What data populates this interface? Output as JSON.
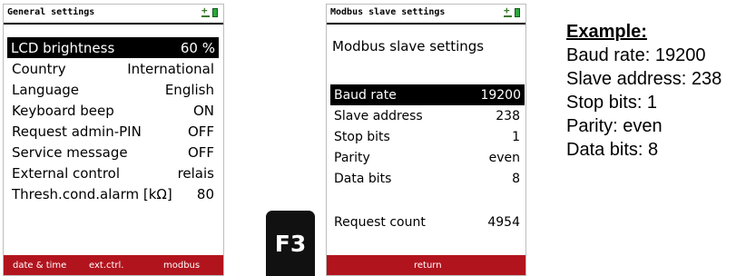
{
  "colors": {
    "selection_bg": "#000000",
    "softkey_bar": "#b2141e",
    "status_green": "#2aa83a"
  },
  "screen1": {
    "title": "General settings",
    "rows": [
      {
        "label": "LCD brightness",
        "value": "60 %"
      },
      {
        "label": "Country",
        "value": "International"
      },
      {
        "label": "Language",
        "value": "English"
      },
      {
        "label": "Keyboard beep",
        "value": "ON"
      },
      {
        "label": "Request admin-PIN",
        "value": "OFF"
      },
      {
        "label": "Service message",
        "value": "OFF"
      },
      {
        "label": "External control",
        "value": "relais"
      },
      {
        "label": "Thresh.cond.alarm [kΩ]",
        "value": "80"
      }
    ],
    "softkeys": [
      "date & time",
      "ext.ctrl.",
      "modbus"
    ]
  },
  "f3_key": {
    "label": "F3"
  },
  "screen2": {
    "title": "Modbus slave settings",
    "heading": "Modbus slave settings",
    "rows": [
      {
        "label": "Baud rate",
        "value": "19200"
      },
      {
        "label": "Slave address",
        "value": "238"
      },
      {
        "label": "Stop bits",
        "value": "1"
      },
      {
        "label": "Parity",
        "value": "even"
      },
      {
        "label": "Data bits",
        "value": "8"
      }
    ],
    "request_count": {
      "label": "Request count",
      "value": "4954"
    },
    "softkeys": [
      "return"
    ]
  },
  "example": {
    "title": "Example:",
    "lines": [
      "Baud rate: 19200",
      "Slave address: 238",
      "Stop bits: 1",
      "Parity: even",
      "Data bits: 8"
    ]
  }
}
